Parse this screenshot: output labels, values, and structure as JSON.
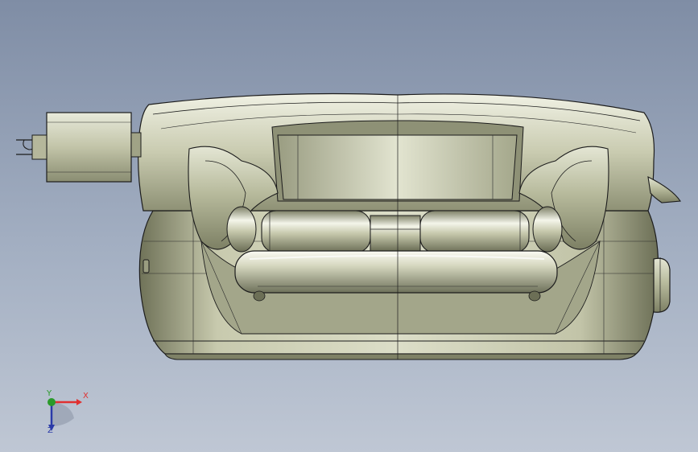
{
  "viewport": {
    "background_top": "#7f8da5",
    "background_bottom": "#bfc7d4"
  },
  "model": {
    "body_color": "#b9bb9e",
    "edge_color": "#1c1c1c"
  },
  "triad": {
    "x_label": "X",
    "y_label": "Y",
    "z_label": "Z",
    "x_color": "#e03030",
    "y_color": "#2a9a2a",
    "z_color": "#2a3aa8"
  }
}
